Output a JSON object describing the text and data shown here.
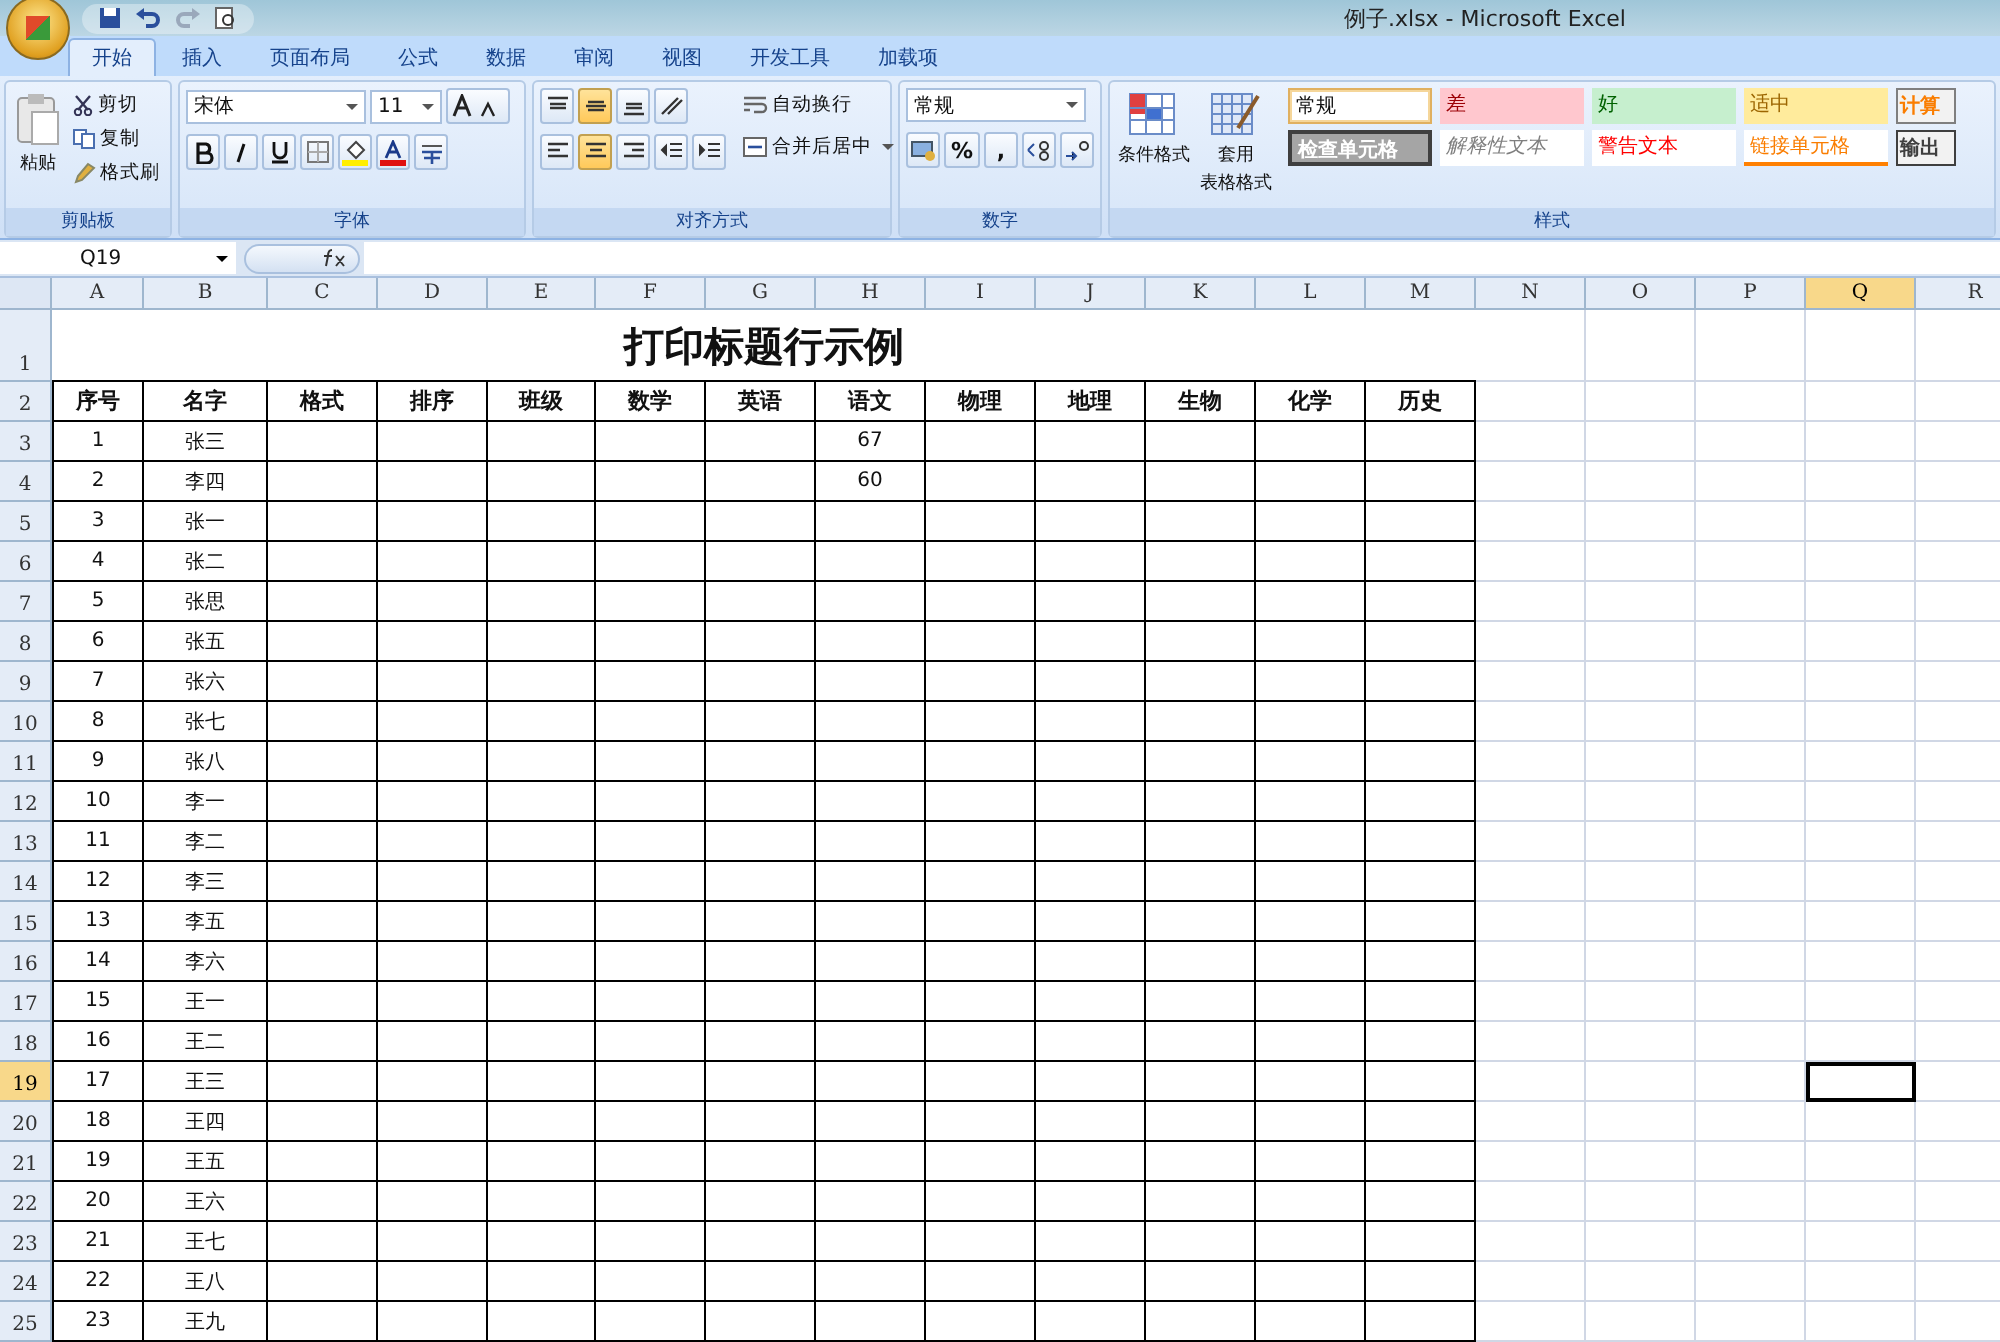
{
  "window": {
    "title": "例子.xlsx - Microsoft Excel"
  },
  "tabs": [
    {
      "label": "开始",
      "selected": true
    },
    {
      "label": "插入",
      "selected": false
    },
    {
      "label": "页面布局",
      "selected": false
    },
    {
      "label": "公式",
      "selected": false
    },
    {
      "label": "数据",
      "selected": false
    },
    {
      "label": "审阅",
      "selected": false
    },
    {
      "label": "视图",
      "selected": false
    },
    {
      "label": "开发工具",
      "selected": false
    },
    {
      "label": "加载项",
      "selected": false
    }
  ],
  "clipboard": {
    "paste": "粘贴",
    "cut": "剪切",
    "copy": "复制",
    "format_painter": "格式刷",
    "group": "剪贴板"
  },
  "font": {
    "name": "宋体",
    "size": "11",
    "group": "字体"
  },
  "alignment": {
    "wrap": "自动换行",
    "merge": "合并后居中",
    "group": "对齐方式"
  },
  "number": {
    "format": "常规",
    "percent": "%",
    "comma": ",",
    "group": "数字"
  },
  "styles": {
    "conditional": "条件格式",
    "table_format_1": "套用",
    "table_format_2": "表格格式",
    "group": "样式",
    "cells": [
      {
        "label": "常规",
        "kind": "normal"
      },
      {
        "label": "差",
        "kind": "bad"
      },
      {
        "label": "好",
        "kind": "good"
      },
      {
        "label": "适中",
        "kind": "neutral"
      },
      {
        "label": "计算",
        "kind": "calc"
      },
      {
        "label": "检查单元格",
        "kind": "check"
      },
      {
        "label": "解释性文本",
        "kind": "explanatory"
      },
      {
        "label": "警告文本",
        "kind": "warning"
      },
      {
        "label": "链接单元格",
        "kind": "linked"
      },
      {
        "label": "输出",
        "kind": "output"
      }
    ]
  },
  "name_box": "Q19",
  "columns": [
    {
      "label": "A",
      "selected": false
    },
    {
      "label": "B",
      "selected": false
    },
    {
      "label": "C",
      "selected": false
    },
    {
      "label": "D",
      "selected": false
    },
    {
      "label": "E",
      "selected": false
    },
    {
      "label": "F",
      "selected": false
    },
    {
      "label": "G",
      "selected": false
    },
    {
      "label": "H",
      "selected": false
    },
    {
      "label": "I",
      "selected": false
    },
    {
      "label": "J",
      "selected": false
    },
    {
      "label": "K",
      "selected": false
    },
    {
      "label": "L",
      "selected": false
    },
    {
      "label": "M",
      "selected": false
    },
    {
      "label": "N",
      "selected": false
    },
    {
      "label": "O",
      "selected": false
    },
    {
      "label": "P",
      "selected": false
    },
    {
      "label": "Q",
      "selected": true
    },
    {
      "label": "R",
      "selected": false
    }
  ],
  "sheet_title": {
    "row": "1",
    "text": "打印标题行示例"
  },
  "header_row": {
    "row": "2",
    "labels": [
      "序号",
      "名字",
      "格式",
      "排序",
      "班级",
      "数学",
      "英语",
      "语文",
      "物理",
      "地理",
      "生物",
      "化学",
      "历史"
    ]
  },
  "rows": [
    {
      "row": "3",
      "id": "1",
      "name": "张三",
      "chinese": "67",
      "selected": false
    },
    {
      "row": "4",
      "id": "2",
      "name": "李四",
      "chinese": "60",
      "selected": false
    },
    {
      "row": "5",
      "id": "3",
      "name": "张一",
      "selected": false
    },
    {
      "row": "6",
      "id": "4",
      "name": "张二",
      "selected": false
    },
    {
      "row": "7",
      "id": "5",
      "name": "张思",
      "selected": false
    },
    {
      "row": "8",
      "id": "6",
      "name": "张五",
      "selected": false
    },
    {
      "row": "9",
      "id": "7",
      "name": "张六",
      "selected": false
    },
    {
      "row": "10",
      "id": "8",
      "name": "张七",
      "selected": false
    },
    {
      "row": "11",
      "id": "9",
      "name": "张八",
      "selected": false
    },
    {
      "row": "12",
      "id": "10",
      "name": "李一",
      "selected": false
    },
    {
      "row": "13",
      "id": "11",
      "name": "李二",
      "selected": false
    },
    {
      "row": "14",
      "id": "12",
      "name": "李三",
      "selected": false
    },
    {
      "row": "15",
      "id": "13",
      "name": "李五",
      "selected": false
    },
    {
      "row": "16",
      "id": "14",
      "name": "李六",
      "selected": false
    },
    {
      "row": "17",
      "id": "15",
      "name": "王一",
      "selected": false
    },
    {
      "row": "18",
      "id": "16",
      "name": "王二",
      "selected": false
    },
    {
      "row": "19",
      "id": "17",
      "name": "王三",
      "selected": true
    },
    {
      "row": "20",
      "id": "18",
      "name": "王四",
      "selected": false
    },
    {
      "row": "21",
      "id": "19",
      "name": "王五",
      "selected": false
    },
    {
      "row": "22",
      "id": "20",
      "name": "王六",
      "selected": false
    },
    {
      "row": "23",
      "id": "21",
      "name": "王七",
      "selected": false
    },
    {
      "row": "24",
      "id": "22",
      "name": "王八",
      "selected": false
    },
    {
      "row": "25",
      "id": "23",
      "name": "王九",
      "selected": false
    }
  ]
}
